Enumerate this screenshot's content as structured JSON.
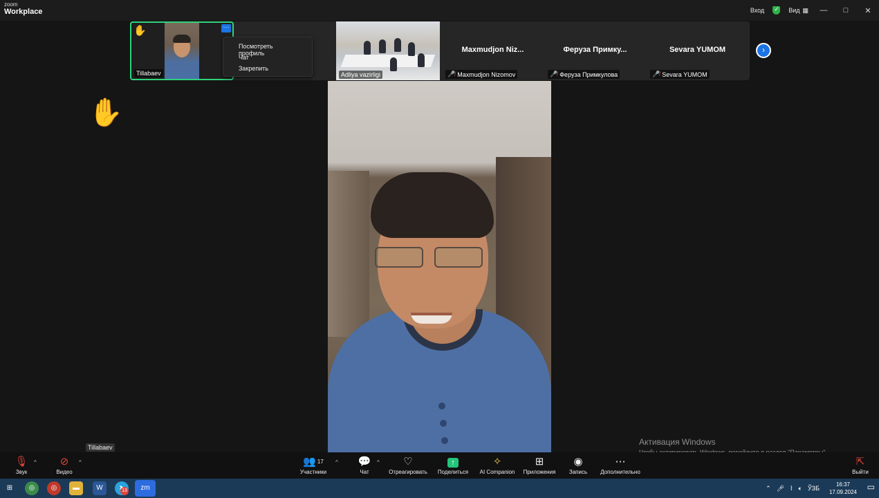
{
  "app": {
    "logo_small": "zoom",
    "logo_big": "Workplace"
  },
  "titlebar": {
    "signin": "Вход",
    "view": "Вид",
    "minimize": "—",
    "maximize": "□",
    "close": "✕"
  },
  "filmstrip": {
    "active": {
      "name": "Tillabaev"
    },
    "context_menu": [
      "Посмотреть профиль",
      "Чат",
      "Закрепить"
    ],
    "room": {
      "name": "Adliya vazirligi"
    },
    "participants": [
      {
        "big_label": "Maxmudjon  Niz...",
        "name": "Maxmudjon Nizomov"
      },
      {
        "big_label": "Феруза  Примку...",
        "name": "Феруза Примкулова"
      },
      {
        "big_label": "Sevara YUMOM",
        "name": "Sevara YUMOM"
      }
    ]
  },
  "main": {
    "speaker_tag": "Tillabaev",
    "activation_title": "Активация Windows",
    "activation_sub": "Чтобы активировать Windows, перейдите в раздел \"Параметры\"."
  },
  "toolbar": {
    "audio": "Звук",
    "video": "Видео",
    "participants": "Участники",
    "participants_count": "17",
    "chat": "Чат",
    "react": "Отреагировать",
    "share": "Поделиться",
    "ai": "AI Companion",
    "apps": "Приложения",
    "record": "Запись",
    "more": "Дополнительно",
    "leave": "Выйти"
  },
  "taskbar": {
    "lang": "ЎЗБ",
    "time": "16:37",
    "date": "17.09.2024",
    "badge": "13"
  },
  "colors": {
    "accent": "#1b74e4",
    "active_border": "#2fd47c",
    "share": "#24c47a",
    "muted": "#e0443c"
  }
}
